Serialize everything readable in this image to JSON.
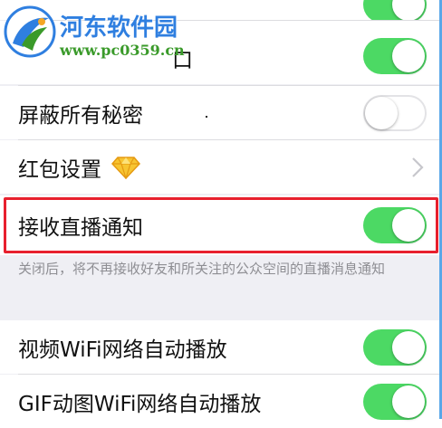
{
  "watermark": {
    "title": "河东软件园",
    "url": "www.pc0359.cn"
  },
  "settings": [
    {
      "id": "top-partial",
      "label": "",
      "control": "toggle",
      "state": "on"
    },
    {
      "id": "row-partial-2",
      "label": "口",
      "control": "toggle",
      "state": "on"
    },
    {
      "id": "hide-secrets",
      "label": "屏蔽所有秘密",
      "control": "toggle",
      "state": "off"
    },
    {
      "id": "red-packet",
      "label": "红包设置",
      "control": "chevron",
      "icon": "diamond-icon"
    },
    {
      "id": "live-notify",
      "label": "接收直播通知",
      "control": "toggle",
      "state": "on",
      "highlighted": true
    },
    {
      "id": "video-wifi-autoplay",
      "label": "视频WiFi网络自动播放",
      "control": "toggle",
      "state": "on"
    },
    {
      "id": "gif-wifi-autoplay",
      "label": "GIF动图WiFi网络自动播放",
      "control": "toggle",
      "state": "on"
    }
  ],
  "live_notify_note": "关闭后，将不再接收好友和所关注的公众空间的直播消息通知",
  "colors": {
    "toggle_on": "#4cd964",
    "highlight_border": "#e8202e",
    "background": "#efeff4",
    "watermark_title": "#2f7fe0",
    "watermark_url": "#3a9a2a"
  }
}
